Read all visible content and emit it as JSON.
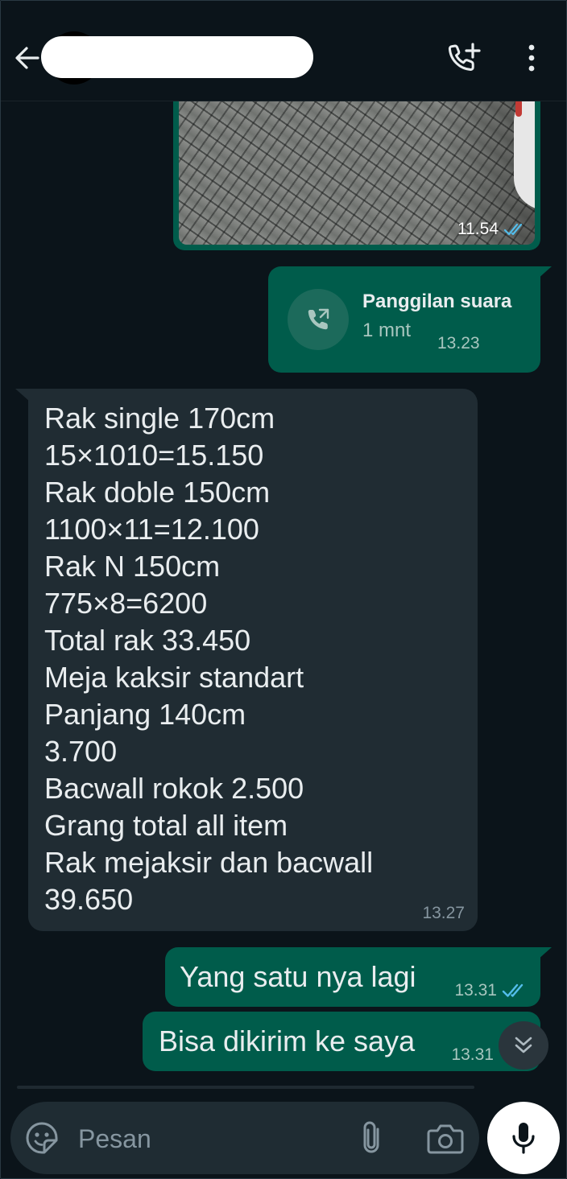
{
  "header": {
    "back_icon": "arrow-left-icon",
    "add_call_icon": "phone-plus-icon",
    "menu_icon": "more-vertical-icon"
  },
  "messages": {
    "image": {
      "time": "11.54",
      "status_icon": "double-check-read-icon",
      "status_color": "#53bdeb"
    },
    "call": {
      "icon": "outgoing-call-icon",
      "title": "Panggilan suara",
      "duration": "1 mnt",
      "time": "13.23"
    },
    "incoming": {
      "lines": [
        "Rak single 170cm",
        "15×1010=15.150",
        "Rak doble 150cm",
        "1100×11=12.100",
        "Rak N 150cm",
        "775×8=6200",
        "Total rak 33.450",
        "Meja kaksir standart",
        "Panjang 140cm",
        "3.700",
        "Bacwall rokok 2.500",
        "Grang total all item",
        "Rak mejaksir dan bacwall",
        "39.650"
      ],
      "time": "13.27"
    },
    "outgoing": [
      {
        "text": "Yang satu nya lagi",
        "time": "13.31",
        "status_icon": "double-check-read-icon"
      },
      {
        "text": "Bisa dikirim ke saya",
        "time": "13.31"
      }
    ]
  },
  "scroll_down_icon": "double-chevron-down-icon",
  "composer": {
    "placeholder": "Pesan",
    "emoji_icon": "sticker-icon",
    "attach_icon": "paperclip-icon",
    "camera_icon": "camera-icon",
    "mic_icon": "microphone-icon"
  },
  "colors": {
    "background": "#0b141a",
    "outgoing_bubble": "#005c4b",
    "incoming_bubble": "#202c33",
    "read_check": "#53bdeb"
  }
}
